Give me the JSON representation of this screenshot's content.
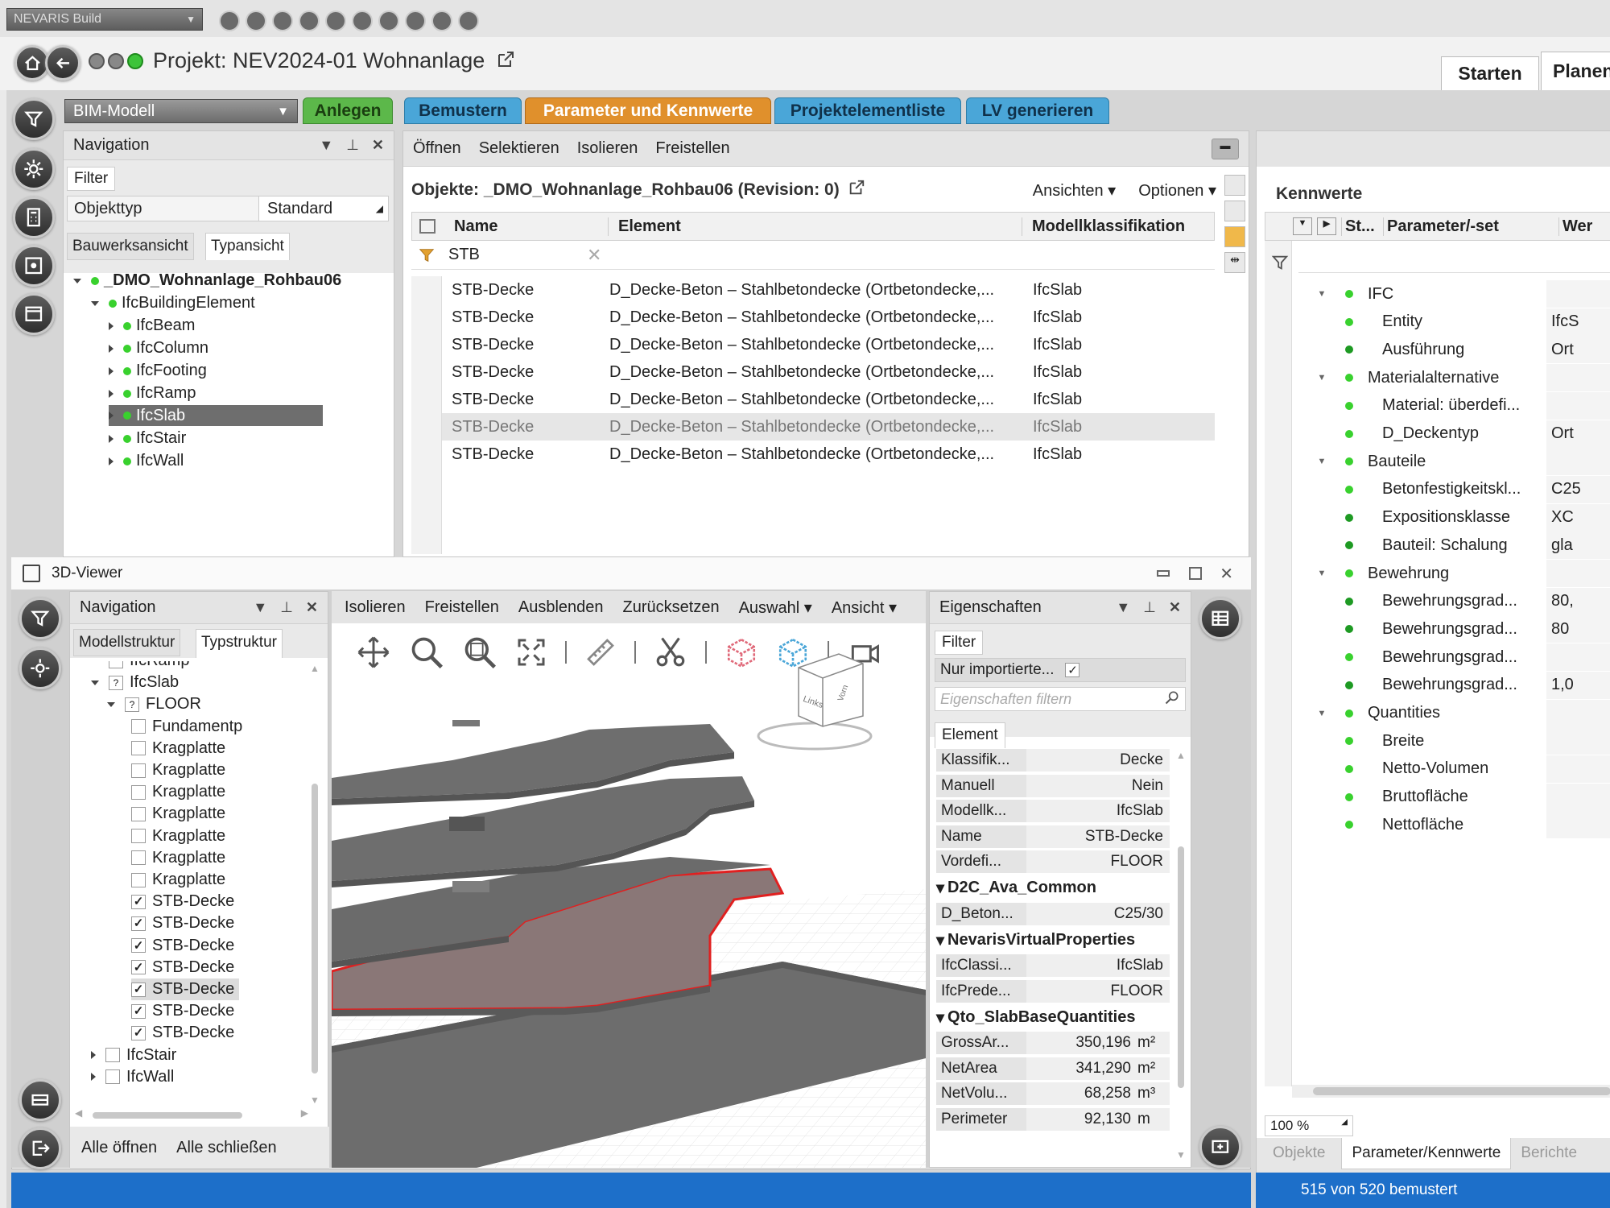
{
  "app": {
    "title_dropdown": "NEVARIS Build",
    "project_title": "Projekt: NEV2024-01 Wohnanlage",
    "top_tabs": [
      "Starten",
      "Planen"
    ]
  },
  "ribbon": {
    "model_select": "BIM-Modell",
    "tabs": [
      {
        "label": "Anlegen",
        "color": "#5cb84a"
      },
      {
        "label": "Bemustern",
        "color": "#4aa6d8"
      },
      {
        "label": "Parameter und Kennwerte",
        "color": "#e0902c"
      },
      {
        "label": "Projektelementliste",
        "color": "#4aa6d8"
      },
      {
        "label": "LV generieren",
        "color": "#4aa6d8"
      }
    ]
  },
  "nav_top": {
    "title": "Navigation",
    "filter_tab": "Filter",
    "filter_field": "Objekttyp",
    "filter_value": "Standard",
    "tabs": [
      "Bauwerksansicht",
      "Typansicht"
    ],
    "tree": [
      {
        "label": "_DMO_Wohnanlage_Rohbau06",
        "level": 0,
        "expanded": true,
        "bold": true
      },
      {
        "label": "IfcBuildingElement",
        "level": 1,
        "expanded": true
      },
      {
        "label": "IfcBeam",
        "level": 2
      },
      {
        "label": "IfcColumn",
        "level": 2
      },
      {
        "label": "IfcFooting",
        "level": 2
      },
      {
        "label": "IfcRamp",
        "level": 2
      },
      {
        "label": "IfcSlab",
        "level": 2,
        "selected": true
      },
      {
        "label": "IfcStair",
        "level": 2
      },
      {
        "label": "IfcWall",
        "level": 2
      }
    ]
  },
  "objects": {
    "toolbar": [
      "Öffnen",
      "Selektieren",
      "Isolieren",
      "Freistellen"
    ],
    "title": "Objekte: _DMO_Wohnanlage_Rohbau06 (Revision: 0)",
    "menus": [
      "Ansichten",
      "Optionen"
    ],
    "columns": [
      "Name",
      "Element",
      "Modellklassifikation"
    ],
    "filter_text": "STB",
    "rows": [
      {
        "name": "STB-Decke",
        "element": "D_Decke-Beton – Stahlbetondecke (Ortbetondecke,...",
        "class": "IfcSlab"
      },
      {
        "name": "STB-Decke",
        "element": "D_Decke-Beton – Stahlbetondecke (Ortbetondecke,...",
        "class": "IfcSlab"
      },
      {
        "name": "STB-Decke",
        "element": "D_Decke-Beton – Stahlbetondecke (Ortbetondecke,...",
        "class": "IfcSlab"
      },
      {
        "name": "STB-Decke",
        "element": "D_Decke-Beton – Stahlbetondecke (Ortbetondecke,...",
        "class": "IfcSlab"
      },
      {
        "name": "STB-Decke",
        "element": "D_Decke-Beton – Stahlbetondecke (Ortbetondecke,...",
        "class": "IfcSlab"
      },
      {
        "name": "STB-Decke",
        "element": "D_Decke-Beton – Stahlbetondecke (Ortbetondecke,...",
        "class": "IfcSlab",
        "selected": true
      },
      {
        "name": "STB-Decke",
        "element": "D_Decke-Beton – Stahlbetondecke (Ortbetondecke,...",
        "class": "IfcSlab"
      }
    ]
  },
  "kennwerte": {
    "title": "Kennwerte",
    "columns": [
      "St...",
      "Parameter/-set",
      "Wer"
    ],
    "rows": [
      {
        "label": "IFC",
        "level": 0,
        "value": ""
      },
      {
        "label": "Entity",
        "level": 1,
        "value": "IfcS"
      },
      {
        "label": "Ausführung",
        "level": 1,
        "value": "Ort",
        "dark": true
      },
      {
        "label": "Materialalternative",
        "level": 0,
        "value": ""
      },
      {
        "label": "Material: überdefi...",
        "level": 1,
        "value": ""
      },
      {
        "label": "D_Deckentyp",
        "level": 1,
        "value": "Ort"
      },
      {
        "label": "Bauteile",
        "level": 0,
        "value": ""
      },
      {
        "label": "Betonfestigkeitskl...",
        "level": 1,
        "value": "C25"
      },
      {
        "label": "Expositionsklasse",
        "level": 1,
        "value": "XC",
        "dark": true
      },
      {
        "label": "Bauteil: Schalung",
        "level": 1,
        "value": "gla",
        "dark": true
      },
      {
        "label": "Bewehrung",
        "level": 0,
        "value": ""
      },
      {
        "label": "Bewehrungsgrad...",
        "level": 1,
        "value": "80,",
        "dark": true
      },
      {
        "label": "Bewehrungsgrad...",
        "level": 1,
        "value": "80",
        "dark": true
      },
      {
        "label": "Bewehrungsgrad...",
        "level": 1,
        "value": ""
      },
      {
        "label": "Bewehrungsgrad...",
        "level": 1,
        "value": "1,0",
        "dark": true
      },
      {
        "label": "Quantities",
        "level": 0,
        "value": ""
      },
      {
        "label": "Breite",
        "level": 1,
        "value": ""
      },
      {
        "label": "Netto-Volumen",
        "level": 1,
        "value": ""
      },
      {
        "label": "Bruttofläche",
        "level": 1,
        "value": ""
      },
      {
        "label": "Nettofläche",
        "level": 1,
        "value": ""
      }
    ],
    "zoom": "100 %",
    "bottom_tabs": [
      "Objekte",
      "Parameter/Kennwerte",
      "Berichte"
    ]
  },
  "viewer": {
    "title": "3D-Viewer",
    "toolbar": [
      "Isolieren",
      "Freistellen",
      "Ausblenden",
      "Zurücksetzen",
      "Auswahl",
      "Ansicht"
    ],
    "cube_labels": [
      "Links",
      "Vorn"
    ],
    "nav": {
      "title": "Navigation",
      "tabs": [
        "Modellstruktur",
        "Typstruktur"
      ],
      "tree": [
        {
          "label": "IfcRamp",
          "level": 1,
          "partial": true
        },
        {
          "label": "IfcSlab",
          "level": 1,
          "expanded": true,
          "q": true
        },
        {
          "label": "FLOOR",
          "level": 2,
          "expanded": true,
          "q": true
        },
        {
          "label": "Fundamentp",
          "level": 3,
          "checked": false
        },
        {
          "label": "Kragplatte",
          "level": 3,
          "checked": false
        },
        {
          "label": "Kragplatte",
          "level": 3,
          "checked": false
        },
        {
          "label": "Kragplatte",
          "level": 3,
          "checked": false
        },
        {
          "label": "Kragplatte",
          "level": 3,
          "checked": false
        },
        {
          "label": "Kragplatte",
          "level": 3,
          "checked": false
        },
        {
          "label": "Kragplatte",
          "level": 3,
          "checked": false
        },
        {
          "label": "Kragplatte",
          "level": 3,
          "checked": false
        },
        {
          "label": "STB-Decke",
          "level": 3,
          "checked": true
        },
        {
          "label": "STB-Decke",
          "level": 3,
          "checked": true
        },
        {
          "label": "STB-Decke",
          "level": 3,
          "checked": true
        },
        {
          "label": "STB-Decke",
          "level": 3,
          "checked": true
        },
        {
          "label": "STB-Decke",
          "level": 3,
          "checked": true,
          "selected": true
        },
        {
          "label": "STB-Decke",
          "level": 3,
          "checked": true
        },
        {
          "label": "STB-Decke",
          "level": 3,
          "checked": true
        },
        {
          "label": "IfcStair",
          "level": 1,
          "collapsed": true
        },
        {
          "label": "IfcWall",
          "level": 1,
          "collapsed": true
        }
      ],
      "footer": [
        "Alle öffnen",
        "Alle schließen"
      ]
    },
    "props": {
      "title": "Eigenschaften",
      "filter_tab": "Filter",
      "only_imported": "Nur importierte...",
      "search_placeholder": "Eigenschaften filtern",
      "element_tab": "Element",
      "general": [
        {
          "k": "Klassifik...",
          "v": "Decke"
        },
        {
          "k": "Manuell",
          "v": "Nein"
        },
        {
          "k": "Modellk...",
          "v": "IfcSlab"
        },
        {
          "k": "Name",
          "v": "STB-Decke"
        },
        {
          "k": "Vordefi...",
          "v": "FLOOR"
        }
      ],
      "group1": "D2C_Ava_Common",
      "g1": [
        {
          "k": "D_Beton...",
          "v": "C25/30"
        }
      ],
      "group2": "NevarisVirtualProperties",
      "g2": [
        {
          "k": "IfcClassi...",
          "v": "IfcSlab"
        },
        {
          "k": "IfcPrede...",
          "v": "FLOOR"
        }
      ],
      "group3": "Qto_SlabBaseQuantities",
      "g3": [
        {
          "k": "GrossAr...",
          "v": "350,196",
          "u": "m²"
        },
        {
          "k": "NetArea",
          "v": "341,290",
          "u": "m²"
        },
        {
          "k": "NetVolu...",
          "v": "68,258",
          "u": "m³"
        },
        {
          "k": "Perimeter",
          "v": "92,130",
          "u": "m"
        }
      ]
    }
  },
  "status": "515 von 520 bemustert",
  "colors": {
    "status_bar": "#1d6fc9",
    "selection": "#6e6e6e",
    "highlight_outline": "#e02020"
  }
}
